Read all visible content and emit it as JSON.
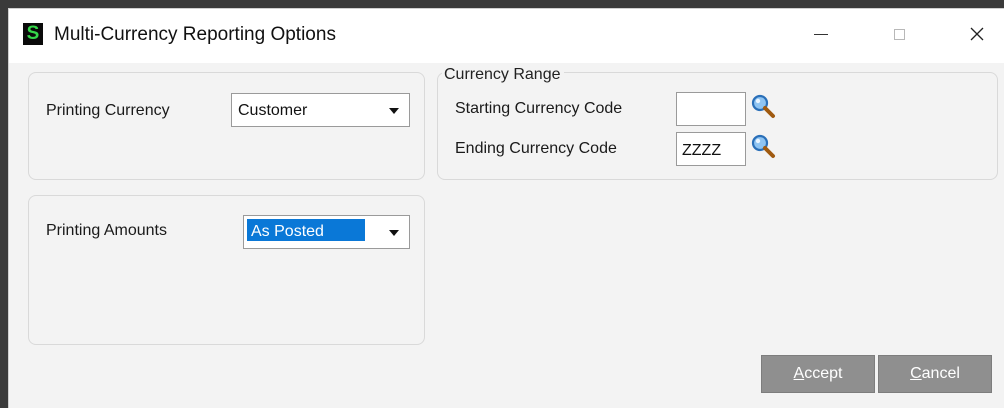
{
  "window": {
    "title": "Multi-Currency Reporting Options",
    "logo_letter": "S",
    "controls": {
      "minimize": "minimize",
      "maximize": "maximize",
      "close": "close"
    }
  },
  "printing_currency": {
    "label": "Printing Currency",
    "selected": "Customer"
  },
  "printing_amounts": {
    "label": "Printing Amounts",
    "selected": "As Posted"
  },
  "currency_range": {
    "title": "Currency Range",
    "starting": {
      "label": "Starting Currency Code",
      "value": ""
    },
    "ending": {
      "label": "Ending Currency Code",
      "value": "ZZZZ"
    },
    "lookup_icon": "magnifier-icon"
  },
  "buttons": {
    "accept": {
      "mnemonic": "A",
      "rest": "ccept"
    },
    "cancel": {
      "mnemonic": "C",
      "rest": "ancel"
    }
  },
  "colors": {
    "selection": "#0a78d7",
    "button_bg": "#8f8f8f",
    "logo_fg": "#35d64a"
  }
}
